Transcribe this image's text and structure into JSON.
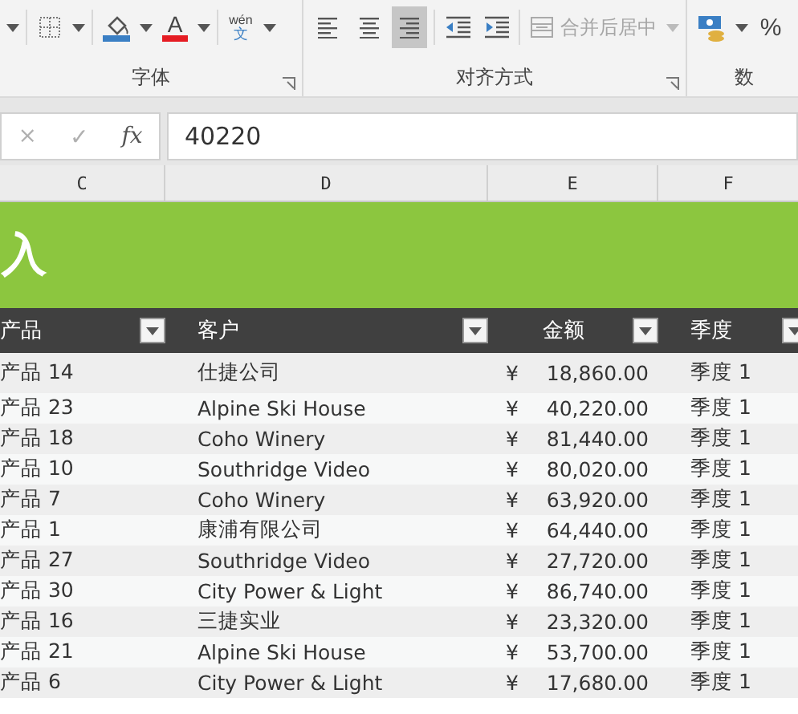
{
  "ribbon": {
    "groups": [
      {
        "label": "字体",
        "launcher": true,
        "items": [
          {
            "kind": "caret"
          },
          {
            "kind": "sep"
          },
          {
            "kind": "borders"
          },
          {
            "kind": "caret"
          },
          {
            "kind": "sep"
          },
          {
            "kind": "fill"
          },
          {
            "kind": "caret"
          },
          {
            "kind": "fontcolor",
            "text": "A"
          },
          {
            "kind": "caret"
          },
          {
            "kind": "sep"
          },
          {
            "kind": "phonetic",
            "text": "wén",
            "sub": "文"
          },
          {
            "kind": "caret"
          }
        ]
      },
      {
        "label": "对齐方式",
        "launcher": true,
        "items": [
          {
            "kind": "align_left",
            "selected": false
          },
          {
            "kind": "align_center",
            "selected": false
          },
          {
            "kind": "align_right",
            "selected": true
          },
          {
            "kind": "sep"
          },
          {
            "kind": "indent_dec"
          },
          {
            "kind": "indent_inc"
          },
          {
            "kind": "sep"
          },
          {
            "kind": "merge",
            "text": "合并后居中",
            "disabled": true
          },
          {
            "kind": "caret",
            "disabled": true
          }
        ]
      },
      {
        "label": "数",
        "items": [
          {
            "kind": "currency"
          },
          {
            "kind": "caret"
          },
          {
            "kind": "percent",
            "text": "%"
          }
        ]
      }
    ]
  },
  "formula_bar": {
    "cancel": "×",
    "enter": "✓",
    "fx": "fx",
    "value": "40220"
  },
  "column_headers": [
    "C",
    "D",
    "E",
    "F"
  ],
  "title": "入",
  "table": {
    "columns": [
      "产品",
      "客户",
      "金额",
      "季度"
    ],
    "rows": [
      {
        "product": "产品 14",
        "customer": "仕捷公司",
        "currency": "¥",
        "amount": "18,860.00",
        "quarter": "季度 1"
      },
      {
        "product": "产品 23",
        "customer": "Alpine Ski House",
        "currency": "¥",
        "amount": "40,220.00",
        "quarter": "季度 1"
      },
      {
        "product": "产品 18",
        "customer": "Coho Winery",
        "currency": "¥",
        "amount": "81,440.00",
        "quarter": "季度 1"
      },
      {
        "product": "产品 10",
        "customer": "Southridge Video",
        "currency": "¥",
        "amount": "80,020.00",
        "quarter": "季度 1"
      },
      {
        "product": "产品 7",
        "customer": "Coho Winery",
        "currency": "¥",
        "amount": "63,920.00",
        "quarter": "季度 1"
      },
      {
        "product": "产品 1",
        "customer": "康浦有限公司",
        "currency": "¥",
        "amount": "64,440.00",
        "quarter": "季度 1"
      },
      {
        "product": "产品 27",
        "customer": "Southridge Video",
        "currency": "¥",
        "amount": "27,720.00",
        "quarter": "季度 1"
      },
      {
        "product": "产品 30",
        "customer": "City Power & Light",
        "currency": "¥",
        "amount": "86,740.00",
        "quarter": "季度 1"
      },
      {
        "product": "产品 16",
        "customer": "三捷实业",
        "currency": "¥",
        "amount": "23,320.00",
        "quarter": "季度 1"
      },
      {
        "product": "产品 21",
        "customer": "Alpine Ski House",
        "currency": "¥",
        "amount": "53,700.00",
        "quarter": "季度 1"
      },
      {
        "product": "产品 6",
        "customer": "City Power & Light",
        "currency": "¥",
        "amount": "17,680.00",
        "quarter": "季度 1"
      }
    ]
  }
}
